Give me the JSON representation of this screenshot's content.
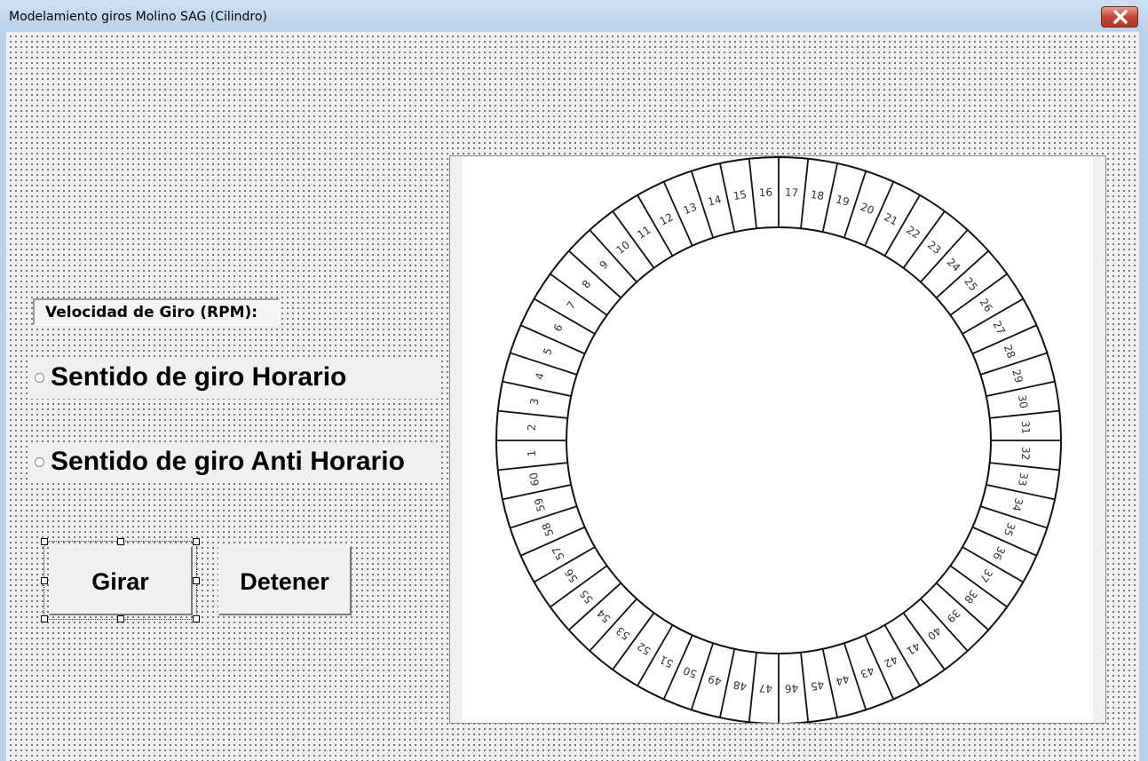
{
  "window": {
    "title": "Modelamiento giros Molino SAG (Cilindro)"
  },
  "form": {
    "speed_label": "Velocidad de Giro (RPM):",
    "radio_clockwise": "Sentido de giro Horario",
    "radio_counterclockwise": "Sentido de giro Anti Horario",
    "button_rotate": "Girar",
    "button_stop": "Detener"
  },
  "mill_diagram": {
    "segment_labels": [
      "1",
      "2",
      "3",
      "4",
      "5",
      "6",
      "7",
      "8",
      "9",
      "10",
      "11",
      "12",
      "13",
      "14",
      "15",
      "16",
      "17",
      "18",
      "19",
      "20",
      "21",
      "22",
      "23",
      "24",
      "25",
      "26",
      "27",
      "28",
      "29",
      "30",
      "31",
      "32",
      "33",
      "34",
      "35",
      "36",
      "37",
      "38",
      "39",
      "40",
      "41",
      "42",
      "43",
      "44",
      "45",
      "46",
      "47",
      "48",
      "49",
      "50",
      "51",
      "52",
      "53",
      "54",
      "55",
      "56",
      "57",
      "58",
      "59",
      "60"
    ]
  }
}
